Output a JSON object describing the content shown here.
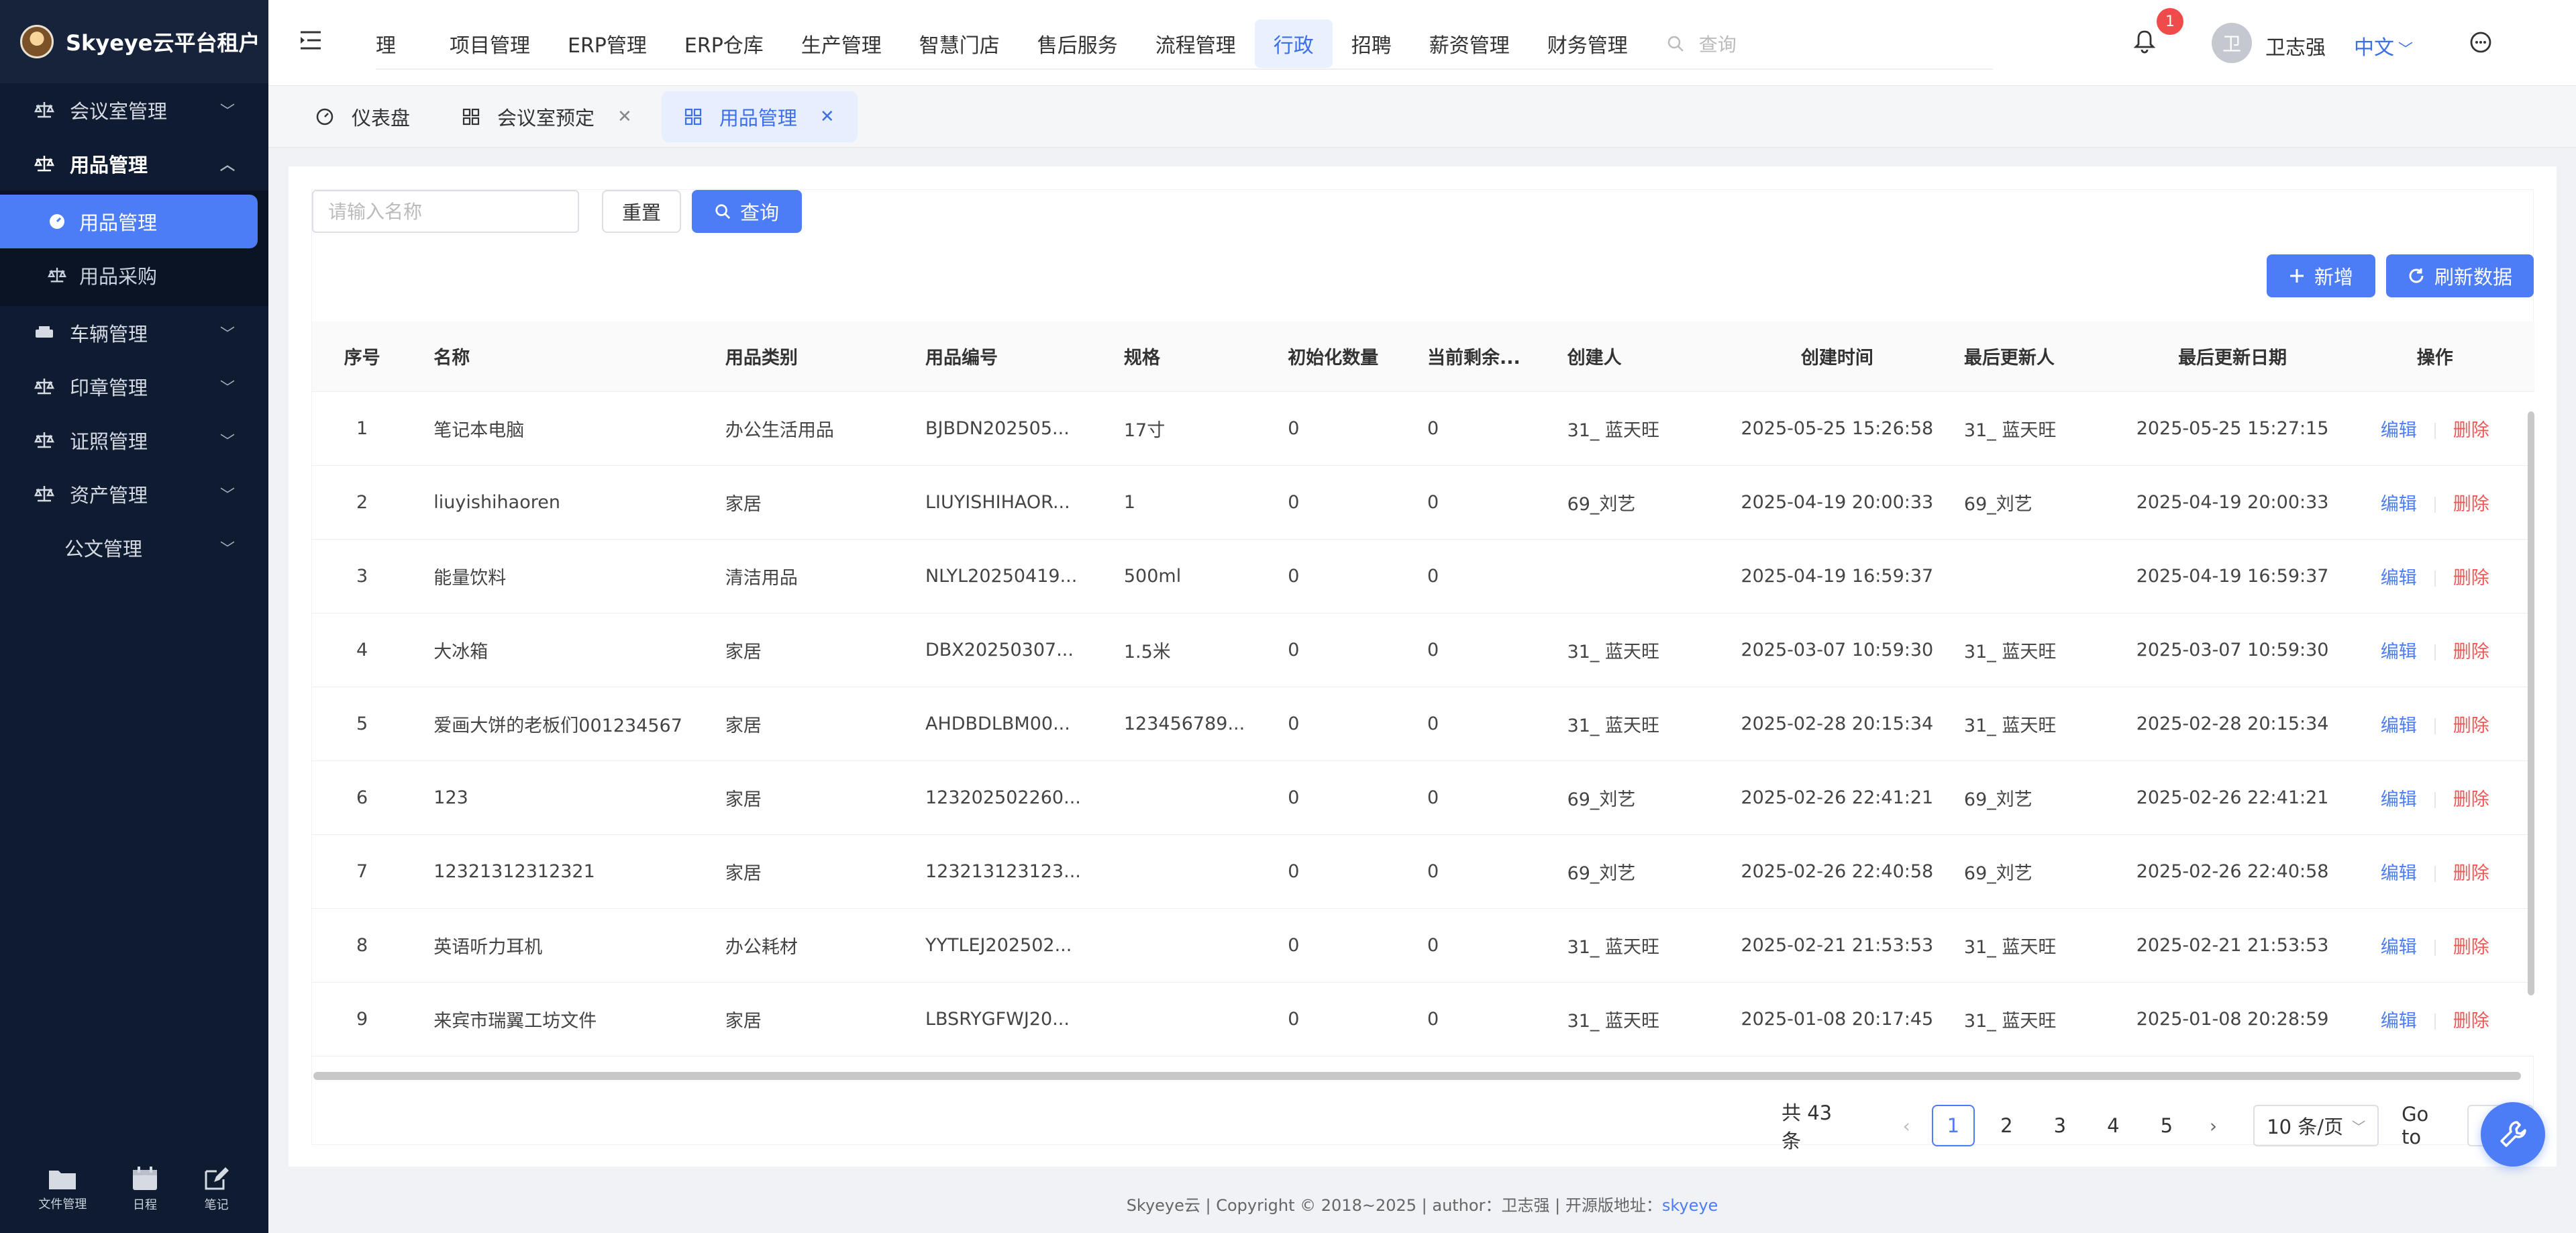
{
  "app": {
    "title": "Skyeye云平台租户"
  },
  "sidebar": {
    "items": [
      {
        "label": "会议室管理",
        "icon": "scale-icon",
        "expanded": false
      },
      {
        "label": "用品管理",
        "icon": "scale-icon",
        "expanded": true,
        "children": [
          {
            "label": "用品管理",
            "icon": "gauge-icon",
            "active": true
          },
          {
            "label": "用品采购",
            "icon": "scale-icon",
            "active": false
          }
        ]
      },
      {
        "label": "车辆管理",
        "icon": "car-icon",
        "expanded": false
      },
      {
        "label": "印章管理",
        "icon": "scale-icon",
        "expanded": false
      },
      {
        "label": "证照管理",
        "icon": "scale-icon",
        "expanded": false
      },
      {
        "label": "资产管理",
        "icon": "scale-icon",
        "expanded": false
      },
      {
        "label": "公文管理",
        "icon": "",
        "expanded": false
      }
    ],
    "tools": [
      {
        "label": "文件管理",
        "icon": "folder-icon"
      },
      {
        "label": "日程",
        "icon": "calendar-icon"
      },
      {
        "label": "笔记",
        "icon": "edit-icon"
      }
    ]
  },
  "topnav": {
    "items": [
      "理",
      "项目管理",
      "ERP管理",
      "ERP仓库",
      "生产管理",
      "智慧门店",
      "售后服务",
      "流程管理",
      "行政",
      "招聘",
      "薪资管理",
      "财务管理"
    ],
    "active_index": 8,
    "search_placeholder": "查询"
  },
  "header": {
    "notification_count": "1",
    "avatar_text": "卫",
    "username": "卫志强",
    "language": "中文"
  },
  "tabs": [
    {
      "label": "仪表盘",
      "icon": "dashboard-icon",
      "closable": false,
      "active": false
    },
    {
      "label": "会议室预定",
      "icon": "grid-icon",
      "closable": true,
      "active": false
    },
    {
      "label": "用品管理",
      "icon": "grid-icon",
      "closable": true,
      "active": true
    }
  ],
  "filters": {
    "name_placeholder": "请输入名称",
    "reset_label": "重置",
    "query_label": "查询",
    "add_label": "新增",
    "refresh_label": "刷新数据"
  },
  "table": {
    "columns": [
      "序号",
      "名称",
      "用品类别",
      "用品编号",
      "规格",
      "初始化数量",
      "当前剩余...",
      "创建人",
      "创建时间",
      "最后更新人",
      "最后更新日期",
      "操作"
    ],
    "edit_label": "编辑",
    "delete_label": "删除",
    "rows": [
      [
        "1",
        "笔记本电脑",
        "办公生活用品",
        "BJBDN202505...",
        "17寸",
        "0",
        "0",
        "31_ 蓝天旺",
        "2025-05-25 15:26:58",
        "31_ 蓝天旺",
        "2025-05-25 15:27:15"
      ],
      [
        "2",
        "liuyishihaoren",
        "家居",
        "LIUYISHIHAOR...",
        "1",
        "0",
        "0",
        "69_刘艺",
        "2025-04-19 20:00:33",
        "69_刘艺",
        "2025-04-19 20:00:33"
      ],
      [
        "3",
        "能量饮料",
        "清洁用品",
        "NLYL20250419...",
        "500ml",
        "0",
        "0",
        "",
        "2025-04-19 16:59:37",
        "",
        "2025-04-19 16:59:37"
      ],
      [
        "4",
        "大冰箱",
        "家居",
        "DBX20250307...",
        "1.5米",
        "0",
        "0",
        "31_ 蓝天旺",
        "2025-03-07 10:59:30",
        "31_ 蓝天旺",
        "2025-03-07 10:59:30"
      ],
      [
        "5",
        "爱画大饼的老板们001234567",
        "家居",
        "AHDBDLBM00...",
        "123456789...",
        "0",
        "0",
        "31_ 蓝天旺",
        "2025-02-28 20:15:34",
        "31_ 蓝天旺",
        "2025-02-28 20:15:34"
      ],
      [
        "6",
        "123",
        "家居",
        "123202502260...",
        "",
        "0",
        "0",
        "69_刘艺",
        "2025-02-26 22:41:21",
        "69_刘艺",
        "2025-02-26 22:41:21"
      ],
      [
        "7",
        "12321312312321",
        "家居",
        "123213123123...",
        "",
        "0",
        "0",
        "69_刘艺",
        "2025-02-26 22:40:58",
        "69_刘艺",
        "2025-02-26 22:40:58"
      ],
      [
        "8",
        "英语听力耳机",
        "办公耗材",
        "YYTLEJ202502...",
        "",
        "0",
        "0",
        "31_ 蓝天旺",
        "2025-02-21 21:53:53",
        "31_ 蓝天旺",
        "2025-02-21 21:53:53"
      ],
      [
        "9",
        "来宾市瑞翼工坊文件",
        "家居",
        "LBSRYGFWJ20...",
        "",
        "0",
        "0",
        "31_ 蓝天旺",
        "2025-01-08 20:17:45",
        "31_ 蓝天旺",
        "2025-01-08 20:28:59"
      ]
    ]
  },
  "pagination": {
    "total_label": "共 43 条",
    "pages": [
      "1",
      "2",
      "3",
      "4",
      "5"
    ],
    "current_page": "1",
    "page_size": "10 条/页",
    "goto_label": "Go to"
  },
  "footer": {
    "text": "Skyeye云 | Copyright © 2018~2025 | author：卫志强 | 开源版地址：",
    "link_label": "skyeye"
  },
  "colors": {
    "primary": "#4c7cf6",
    "sidebar_bg": "#0f1b30",
    "danger": "#f05656"
  }
}
